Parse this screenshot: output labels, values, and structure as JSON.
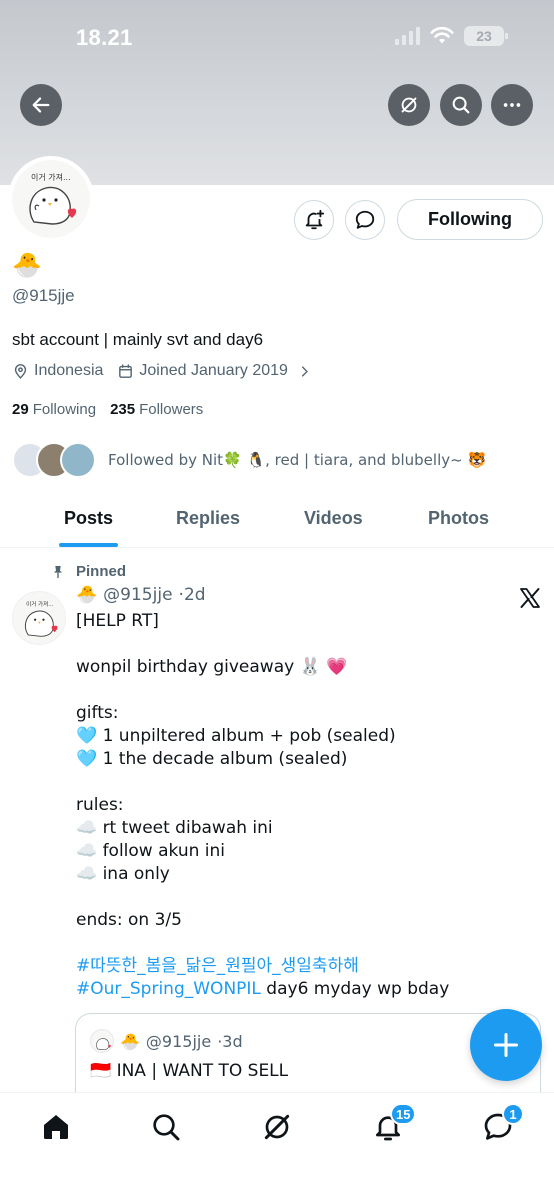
{
  "status_bar": {
    "time": "18.21",
    "battery": "23"
  },
  "profile": {
    "display_name": "🐣",
    "handle": "@915jje",
    "bio": "sbt account | mainly svt and day6",
    "location": "Indonesia",
    "joined": "Joined January 2019",
    "following_count": "29",
    "following_label": "Following",
    "followers_count": "235",
    "followers_label": "Followers",
    "followed_by": "Followed by Nit🍀 🐧, red | tiara, and blubelly~ 🐯",
    "follow_button_label": "Following"
  },
  "tabs": [
    {
      "label": "Posts",
      "active": true
    },
    {
      "label": "Replies",
      "active": false
    },
    {
      "label": "Videos",
      "active": false
    },
    {
      "label": "Photos",
      "active": false
    }
  ],
  "post": {
    "pinned_label": "Pinned",
    "author_emoji": "🐣",
    "handle": "@915jje",
    "time": "2d",
    "lines": [
      "[HELP RT]",
      "",
      "wonpil birthday giveaway 🐰 💗",
      "",
      "gifts:",
      "🩵 1 unpiltered album + pob (sealed)",
      "🩵 1 the decade album (sealed)",
      "",
      "rules:",
      "☁️ rt tweet dibawah ini",
      "☁️ follow akun ini",
      "☁️ ina only",
      "",
      "ends: on 3/5",
      ""
    ],
    "hashtag_1": "#따뜻한_봄을_닮은_원필아_생일축하해",
    "hashtag_2": "#Our_Spring_WONPIL",
    "trailing_text": " day6 myday wp bday"
  },
  "quote": {
    "author_emoji": "🐣",
    "handle": "@915jje",
    "time": "3d",
    "text": "🇮🇩 INA | WANT TO SELL"
  },
  "bottom_nav": {
    "notifications_badge": "15",
    "messages_badge": "1"
  },
  "colors": {
    "accent": "#1d9bf0",
    "text": "#0f1419",
    "secondary": "#536471",
    "border": "#cfd9de"
  }
}
